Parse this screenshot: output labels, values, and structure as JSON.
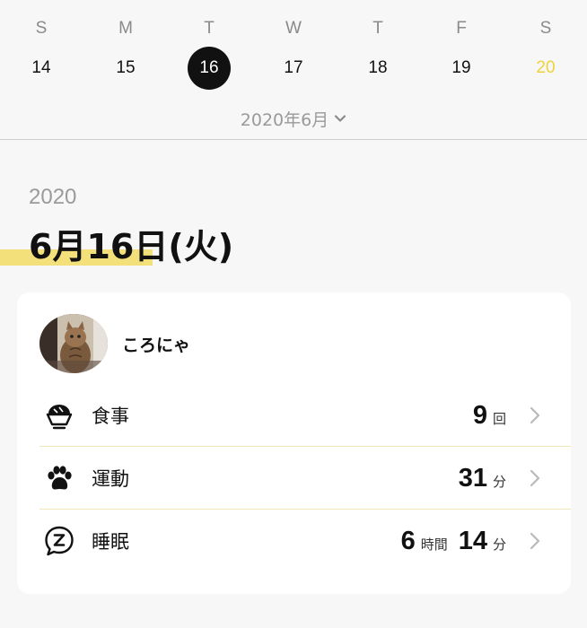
{
  "week": {
    "days_of_week": [
      "S",
      "M",
      "T",
      "W",
      "T",
      "F",
      "S"
    ],
    "dates": [
      "14",
      "15",
      "16",
      "17",
      "18",
      "19",
      "20"
    ],
    "selected_date": "16",
    "month_label": "2020年6月"
  },
  "day": {
    "year": "2020",
    "title": "6月16日(火)"
  },
  "pet": {
    "name": "ころにゃ"
  },
  "metrics": {
    "meal": {
      "label": "食事",
      "value": "9",
      "unit": "回"
    },
    "exercise": {
      "label": "運動",
      "value": "31",
      "unit": "分"
    },
    "sleep": {
      "label": "睡眠",
      "hours": "6",
      "hours_unit": "時間",
      "minutes": "14",
      "minutes_unit": "分"
    }
  },
  "colors": {
    "accent_yellow": "#f4e07a",
    "saturday": "#f0d23a",
    "selected_circle": "#111111"
  }
}
